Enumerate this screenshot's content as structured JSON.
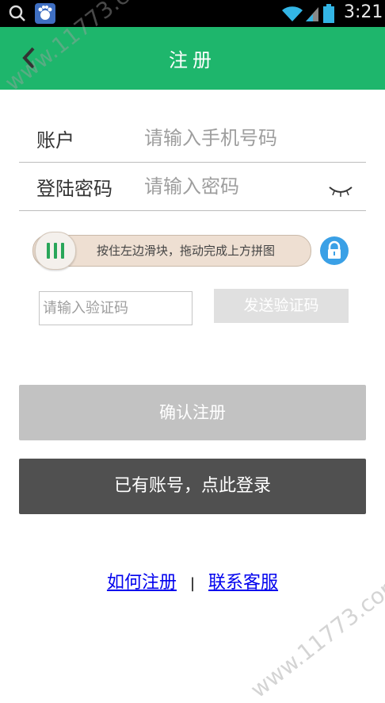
{
  "status_bar": {
    "time": "3:21"
  },
  "header": {
    "title": "注册",
    "back_icon": "chevron-left-icon"
  },
  "form": {
    "account": {
      "label": "账户",
      "placeholder": "请输入手机号码",
      "value": ""
    },
    "password": {
      "label": "登陆密码",
      "placeholder": "请输入密码",
      "value": "",
      "toggle_icon": "closed-eye-icon"
    }
  },
  "slider": {
    "text": "按住左边滑块，拖动完成上方拼图",
    "progress": 0,
    "lock_icon": "lock-icon"
  },
  "verification": {
    "placeholder": "请输入验证码",
    "value": "",
    "send_label": "发送验证码"
  },
  "buttons": {
    "confirm_label": "确认注册",
    "login_label": "已有账号，点此登录"
  },
  "footer": {
    "help_link": "如何注册",
    "separator": "|",
    "contact_link": "联系客服"
  },
  "watermark": {
    "text1": "www.11773.com",
    "text2": "www.11773.com"
  },
  "colors": {
    "header_green": "#1eb66c",
    "confirm_gray": "#c2c2c2",
    "login_dark": "#505050",
    "lock_blue": "#3aa0e6"
  }
}
